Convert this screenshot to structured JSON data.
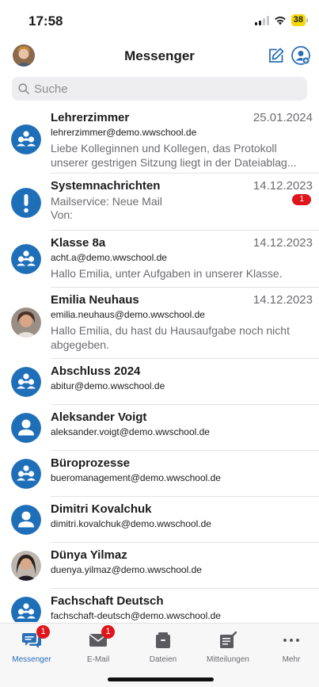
{
  "status_bar": {
    "time": "17:58",
    "battery": "38"
  },
  "header": {
    "title": "Messenger",
    "compose_icon": "compose-icon",
    "new_group_icon": "add-contact-icon"
  },
  "search": {
    "placeholder": "Suche"
  },
  "conversations": [
    {
      "name": "Lehrerzimmer",
      "date": "25.01.2024",
      "email": "lehrerzimmer@demo.wwschool.de",
      "preview": "Liebe Kolleginnen und Kollegen, das Protokoll unserer gestrigen Sitzung liegt in der Dateiablag...",
      "avatar": "group-icon"
    },
    {
      "name": "Systemnachrichten",
      "date": "14.12.2023",
      "preview_line1": "Mailservice: Neue Mail",
      "preview_line2": "Von:",
      "badge": "1",
      "avatar": "alert-icon"
    },
    {
      "name": "Klasse 8a",
      "date": "14.12.2023",
      "email": "acht.a@demo.wwschool.de",
      "preview": "Hallo Emilia, unter Aufgaben in unserer Klasse.",
      "avatar": "group-icon"
    },
    {
      "name": "Emilia Neuhaus",
      "date": "14.12.2023",
      "email": "emilia.neuhaus@demo.wwschool.de",
      "preview": "Hallo Emilia, du hast du Hausaufgabe noch nicht abgegeben.",
      "avatar": "photo"
    },
    {
      "name": "Abschluss 2024",
      "email": "abitur@demo.wwschool.de",
      "avatar": "group-icon"
    },
    {
      "name": "Aleksander Voigt",
      "email": "aleksander.voigt@demo.wwschool.de",
      "avatar": "person-icon"
    },
    {
      "name": "Büroprozesse",
      "email": "bueromanagement@demo.wwschool.de",
      "avatar": "group-icon"
    },
    {
      "name": "Dimitri Kovalchuk",
      "email": "dimitri.kovalchuk@demo.wwschool.de",
      "avatar": "person-icon"
    },
    {
      "name": "Dünya Yilmaz",
      "email": "duenya.yilmaz@demo.wwschool.de",
      "avatar": "photo"
    },
    {
      "name": "Fachschaft Deutsch",
      "email": "fachschaft-deutsch@demo.wwschool.de",
      "avatar": "group-icon"
    }
  ],
  "tabs": [
    {
      "label": "Messenger",
      "badge": "1",
      "icon": "chat-icon",
      "active": true
    },
    {
      "label": "E-Mail",
      "badge": "1",
      "icon": "mail-icon"
    },
    {
      "label": "Dateien",
      "icon": "files-icon"
    },
    {
      "label": "Mitteilungen",
      "icon": "notices-icon"
    },
    {
      "label": "Mehr",
      "icon": "more-icon"
    }
  ],
  "colors": {
    "accent": "#2a6fb5",
    "avatar_blue": "#1f6fb8",
    "badge_red": "#e0151c"
  }
}
